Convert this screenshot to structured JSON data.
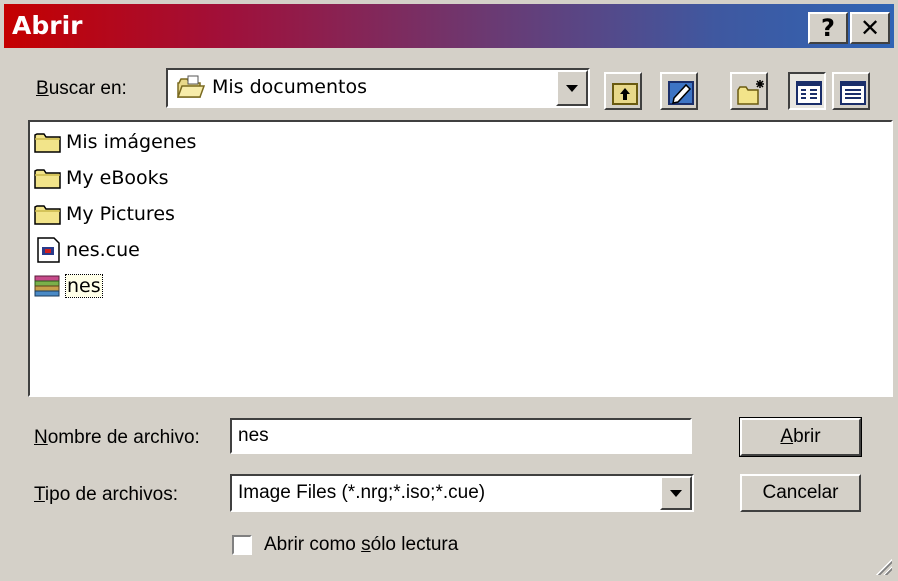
{
  "window": {
    "title": "Abrir",
    "help_label": "?",
    "close_label": "✕"
  },
  "lookin": {
    "label": "Buscar en:",
    "accesskey": "B",
    "label_rest": "uscar en:",
    "value": "Mis documentos",
    "icon": "open-folder-icon"
  },
  "toolbar": {
    "buttons": [
      "up-one-level",
      "desktop",
      "create-new-folder",
      "list-view",
      "details-view"
    ]
  },
  "files": [
    {
      "name": "Mis imágenes",
      "icon": "folder-icon"
    },
    {
      "name": "My eBooks",
      "icon": "folder-icon"
    },
    {
      "name": "My Pictures",
      "icon": "folder-icon"
    },
    {
      "name": "nes.cue",
      "icon": "file-icon"
    },
    {
      "name": "nes",
      "icon": "disc-image-icon",
      "selected": true
    }
  ],
  "filename": {
    "label_key": "N",
    "label_rest": "ombre de archivo:",
    "value": "nes"
  },
  "filetype": {
    "label_key": "T",
    "label_rest": "ipo de archivos:",
    "value": "Image Files (*.nrg;*.iso;*.cue)"
  },
  "readonly": {
    "label_pre": "Abrir como ",
    "label_key": "s",
    "label_rest": "ólo lectura",
    "checked": false
  },
  "buttons": {
    "open_key": "A",
    "open_rest": "brir",
    "cancel": "Cancelar"
  },
  "colors": {
    "dialog_bg": "#d4d0c8",
    "title_start": "#c50000",
    "title_end": "#2f64b4"
  }
}
